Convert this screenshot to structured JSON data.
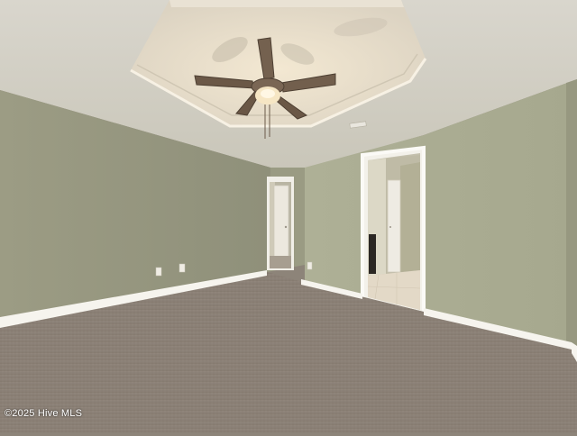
{
  "photo": {
    "watermark": "©2025 Hive MLS"
  },
  "colors": {
    "wall": "#a7a88f",
    "wall_shadow": "#8f917a",
    "ceiling": "#d7d3c7",
    "tray_ceiling": "#e4dccc",
    "trim": "#f4f2ec",
    "carpet": "#8a8075",
    "fan_blade": "#6e5d4c",
    "tile_floor": "#e2d8c6"
  }
}
